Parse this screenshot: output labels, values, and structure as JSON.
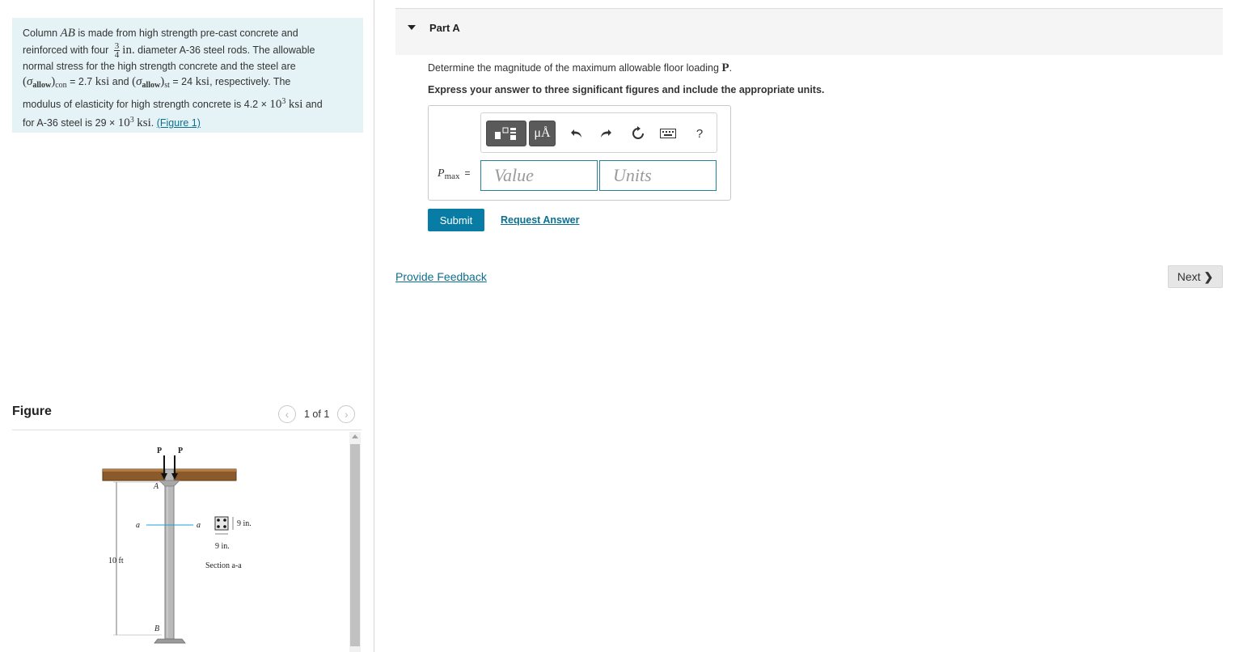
{
  "problem": {
    "text_1": "Column ",
    "var_ab": "AB",
    "text_2": " is made from high strength pre-cast concrete and",
    "text_3": "reinforced with four ",
    "frac_num": "3",
    "frac_den": "4",
    "unit_in": "in.",
    "text_4": " diameter A-36 steel rods. The allowable",
    "text_5": "normal stress for the high strength concrete and the steel are",
    "sigma": "σ",
    "allow": "allow",
    "sub_con": "con",
    "val_con": " = 2.7 ",
    "unit_ksi": "ksi",
    "text_and": " and ",
    "sub_st": "st",
    "val_st": " = 24 ",
    "text_resp": ", respectively. The",
    "text_6": "modulus of elasticity for high strength concrete is 4.2 × ",
    "exp_base": "10",
    "exp_power": "3",
    "text_7": " and",
    "text_8": "for A-36 steel is 29 × ",
    "figure_link": "(Figure 1)"
  },
  "figure": {
    "title": "Figure",
    "pager_text": "1 of 1",
    "prev_glyph": "‹",
    "next_glyph": "›",
    "labels": {
      "p1": "P",
      "p2": "P",
      "a_top": "A",
      "a_left": "a",
      "a_right": "a",
      "b_bottom": "B",
      "height": "10 ft",
      "dim_side": "9 in.",
      "dim_bottom": "9 in.",
      "section": "Section a-a"
    }
  },
  "part": {
    "title": "Part A",
    "question_text": "Determine the magnitude of the maximum allowable floor loading ",
    "question_var": "P",
    "question_end": ".",
    "instruction": "Express your answer to three significant figures and include the appropriate units.",
    "units_button": "μÅ",
    "help_button": "?",
    "answer_label": "P",
    "answer_sub": "max",
    "answer_eq": "=",
    "value_placeholder": "Value",
    "units_placeholder": "Units",
    "submit": "Submit",
    "request_answer": "Request Answer"
  },
  "footer": {
    "feedback": "Provide Feedback",
    "next": "Next",
    "next_glyph": "❯"
  },
  "colors": {
    "problem_bg": "#e5f3f6",
    "link": "#0c6f8f",
    "submit_bg": "#087ca4",
    "input_border": "#2a7f9a",
    "floor": "#8a5a2b",
    "section_line": "#1aa3d9"
  }
}
